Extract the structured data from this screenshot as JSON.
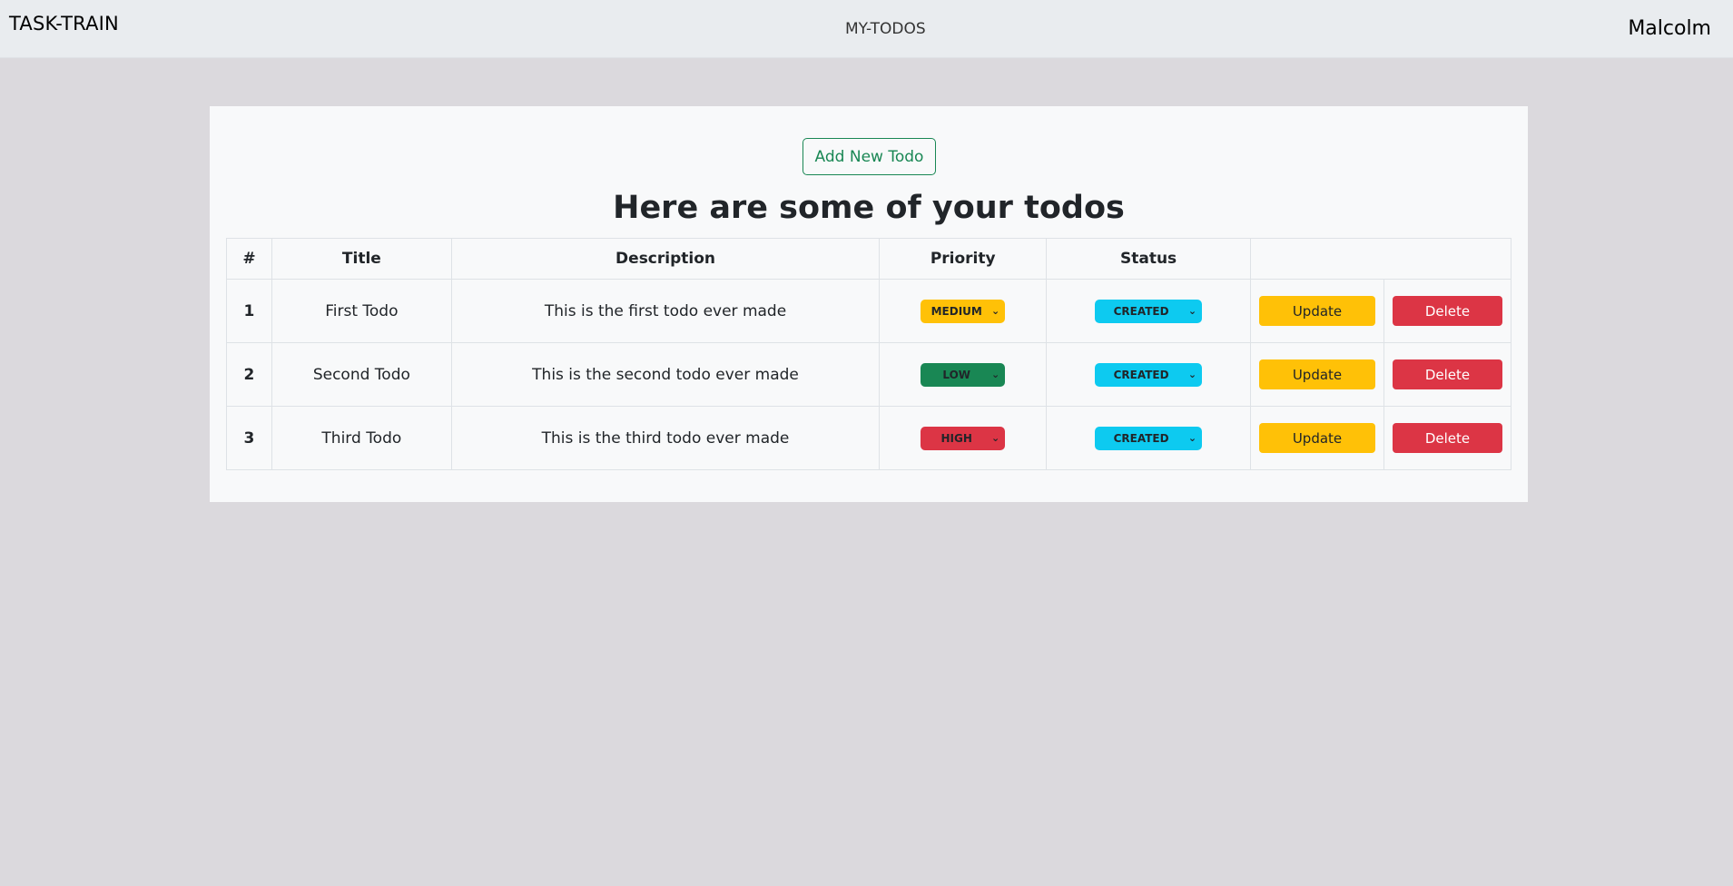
{
  "navbar": {
    "brand": "TASK-TRAIN",
    "link": "MY-TODOS",
    "user": "Malcolm"
  },
  "main": {
    "add_button": "Add New Todo",
    "heading": "Here are some of your todos",
    "columns": [
      "#",
      "Title",
      "Description",
      "Priority",
      "Status",
      ""
    ],
    "rows": [
      {
        "num": "1",
        "title": "First Todo",
        "description": "This is the first todo ever made",
        "priority": "MEDIUM",
        "status": "CREATED"
      },
      {
        "num": "2",
        "title": "Second Todo",
        "description": "This is the second todo ever made",
        "priority": "LOW",
        "status": "CREATED"
      },
      {
        "num": "3",
        "title": "Third Todo",
        "description": "This is the third todo ever made",
        "priority": "HIGH",
        "status": "CREATED"
      }
    ],
    "update_label": "Update",
    "delete_label": "Delete"
  },
  "colors": {
    "medium": "#ffc107",
    "low": "#198754",
    "high": "#dc3545",
    "status": "#0dcaf0",
    "update": "#ffc107",
    "delete": "#dc3545",
    "add_outline": "#198754"
  }
}
